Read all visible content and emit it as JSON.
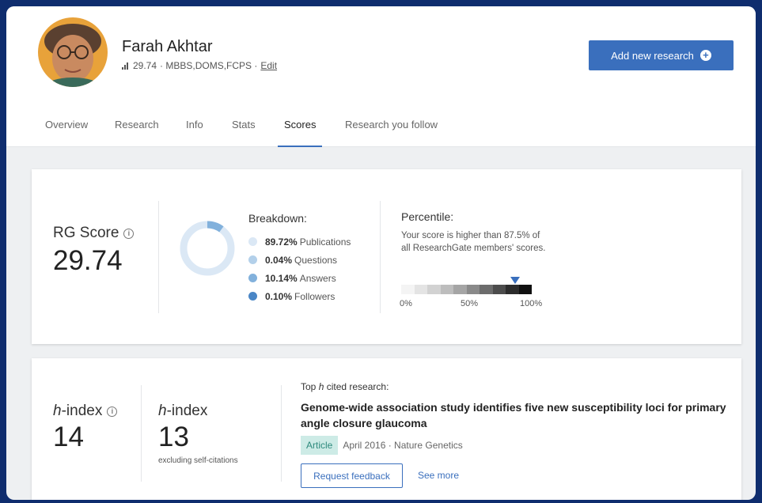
{
  "profile": {
    "name": "Farah Akhtar",
    "score": "29.74",
    "credentials": "· MBBS,DOMS,FCPS ·",
    "edit_label": "Edit",
    "add_research_label": "Add new research"
  },
  "tabs": [
    {
      "label": "Overview"
    },
    {
      "label": "Research"
    },
    {
      "label": "Info"
    },
    {
      "label": "Stats"
    },
    {
      "label": "Scores",
      "active": true
    },
    {
      "label": "Research you follow"
    }
  ],
  "rg_score": {
    "label": "RG Score",
    "value": "29.74",
    "breakdown_title": "Breakdown:",
    "breakdown": [
      {
        "pct": "89.72%",
        "label": "Publications",
        "color": "#dbe8f5"
      },
      {
        "pct": "0.04%",
        "label": "Questions",
        "color": "#b3d0ea"
      },
      {
        "pct": "10.14%",
        "label": "Answers",
        "color": "#82b1dc"
      },
      {
        "pct": "0.10%",
        "label": "Followers",
        "color": "#4a86c6"
      }
    ],
    "percentile_title": "Percentile:",
    "percentile_text": "Your score is higher than 87.5% of all ResearchGate members' scores.",
    "percentile_value": 87.5,
    "percentile_ticks": [
      "0%",
      "50%",
      "100%"
    ]
  },
  "h_index": {
    "label_italic": "h",
    "label_rest": "-index",
    "value": "14",
    "excl_label_italic": "h",
    "excl_label_rest": "-index",
    "excl_value": "13",
    "excl_sub": "excluding self-citations",
    "top_label_pre": "Top ",
    "top_label_italic": "h",
    "top_label_post": " cited research:",
    "paper_title": "Genome-wide association study identifies five new susceptibility loci for primary angle closure glaucoma",
    "badge": "Article",
    "meta": "April 2016 · Nature Genetics",
    "feedback_label": "Request feedback",
    "see_more_label": "See more"
  },
  "colors": {
    "accent": "#3a6fbd",
    "badge_bg": "#cdebe6",
    "badge_text": "#2e8a7d"
  }
}
